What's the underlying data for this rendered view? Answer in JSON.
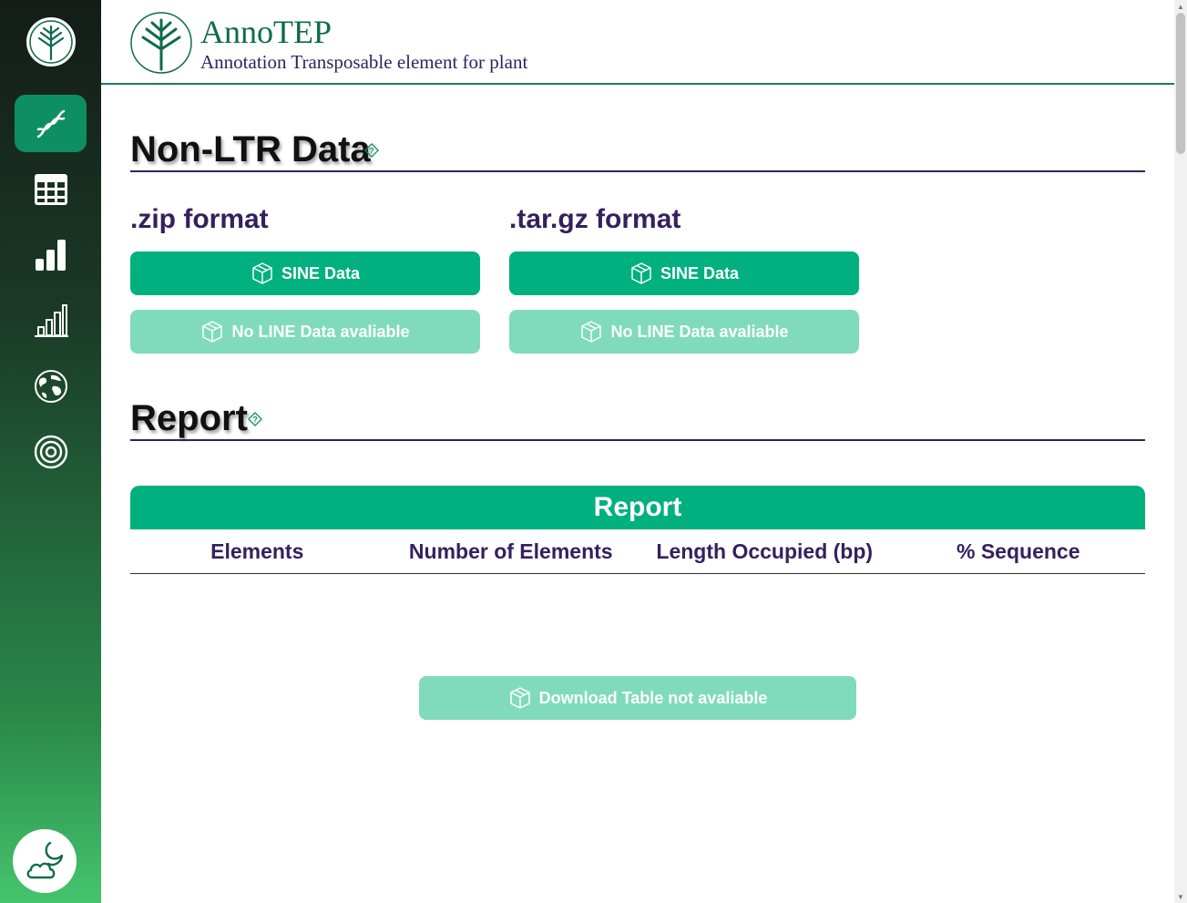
{
  "brand": {
    "title": "AnnoTEP",
    "subtitle": "Annotation Transposable element for plant"
  },
  "sidebar": {
    "items": [
      {
        "name": "dna-icon",
        "active": true
      },
      {
        "name": "table-icon",
        "active": false
      },
      {
        "name": "bar-chart-icon",
        "active": false
      },
      {
        "name": "bar-chart-outline-icon",
        "active": false
      },
      {
        "name": "globe-icon",
        "active": false
      },
      {
        "name": "target-icon",
        "active": false
      }
    ],
    "theme_toggle_icon": "moon-cloud-icon"
  },
  "non_ltr": {
    "title": "Non-LTR Data",
    "zip": {
      "title": ".zip format",
      "sine_label": "SINE Data",
      "line_label": "No LINE Data avaliable"
    },
    "targz": {
      "title": ".tar.gz format",
      "sine_label": "SINE Data",
      "line_label": "No LINE Data avaliable"
    }
  },
  "report": {
    "title": "Report",
    "table_title": "Report",
    "columns": [
      "Elements",
      "Number of Elements",
      "Length Occupied (bp)",
      "% Sequence"
    ],
    "rows": [],
    "download_label": "Download Table not avaliable"
  },
  "colors": {
    "primary": "#00b07e",
    "primary_disabled": "#80dbbd",
    "accent_purple": "#35205e",
    "brand_green": "#0e6b4d"
  }
}
